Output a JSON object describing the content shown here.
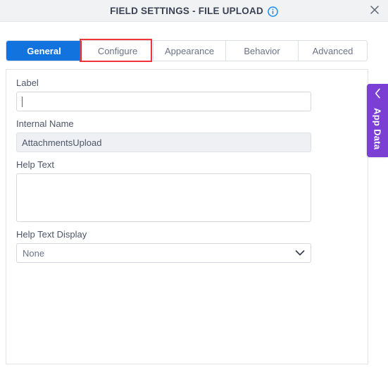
{
  "header": {
    "title": "FIELD SETTINGS - FILE UPLOAD",
    "info_icon": "info-circle-icon",
    "close_icon": "close-icon",
    "background": "#f1f2f4",
    "title_color": "#3b4254"
  },
  "tabs": {
    "active_index": 0,
    "highlight_index": 1,
    "highlight_color": "#f0353a",
    "active_color": "#1273de",
    "items": [
      {
        "label": "General"
      },
      {
        "label": "Configure"
      },
      {
        "label": "Appearance"
      },
      {
        "label": "Behavior"
      },
      {
        "label": "Advanced"
      }
    ]
  },
  "form": {
    "fields": [
      {
        "label": "Label",
        "type": "text",
        "value": "",
        "placeholder": "",
        "readonly": false,
        "focused": true
      },
      {
        "label": "Internal Name",
        "type": "text",
        "value": "AttachmentsUpload",
        "placeholder": "",
        "readonly": true,
        "focused": false
      },
      {
        "label": "Help Text",
        "type": "textarea",
        "value": "",
        "placeholder": "",
        "readonly": false,
        "focused": false
      },
      {
        "label": "Help Text Display",
        "type": "select",
        "value": "None",
        "options": [
          "None"
        ],
        "chevron_icon": "chevron-down-icon",
        "readonly": false,
        "focused": false
      }
    ]
  },
  "side_panel": {
    "label": "App Data",
    "collapse_icon": "chevron-left-icon",
    "color": "#7b3fd4"
  }
}
